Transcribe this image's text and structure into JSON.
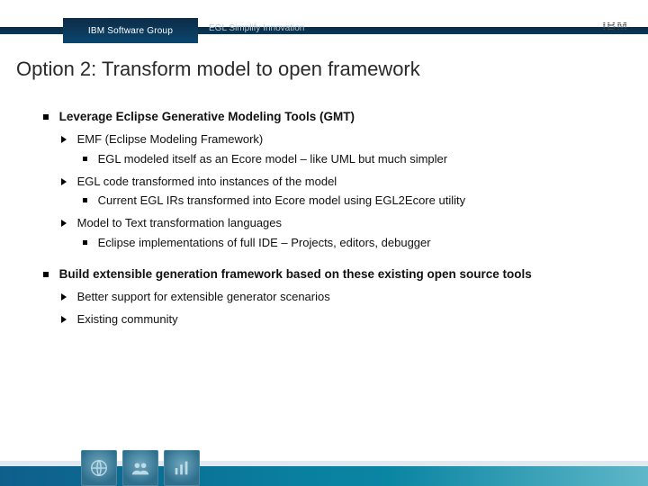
{
  "header": {
    "group_label": "IBM Software Group",
    "subtitle": "EGL Simplify Innovation",
    "logo_text": "IBM"
  },
  "title": "Option 2: Transform model to open framework",
  "bullets": [
    {
      "text": "Leverage Eclipse Generative Modeling Tools (GMT)",
      "children": [
        {
          "text": "EMF (Eclipse Modeling Framework)",
          "children": [
            {
              "text": "EGL modeled itself as an Ecore model – like UML but much simpler"
            }
          ]
        },
        {
          "text": "EGL code transformed into instances of the model",
          "children": [
            {
              "text": "Current EGL IRs transformed into Ecore model using EGL2Ecore utility"
            }
          ]
        },
        {
          "text": "Model to Text transformation languages",
          "children": [
            {
              "text": "Eclipse implementations of full IDE – Projects, editors, debugger"
            }
          ]
        }
      ]
    },
    {
      "text": "Build extensible generation framework based on these existing open source tools",
      "children": [
        {
          "text": "Better support for extensible generator scenarios"
        },
        {
          "text": "Existing community"
        }
      ]
    }
  ]
}
